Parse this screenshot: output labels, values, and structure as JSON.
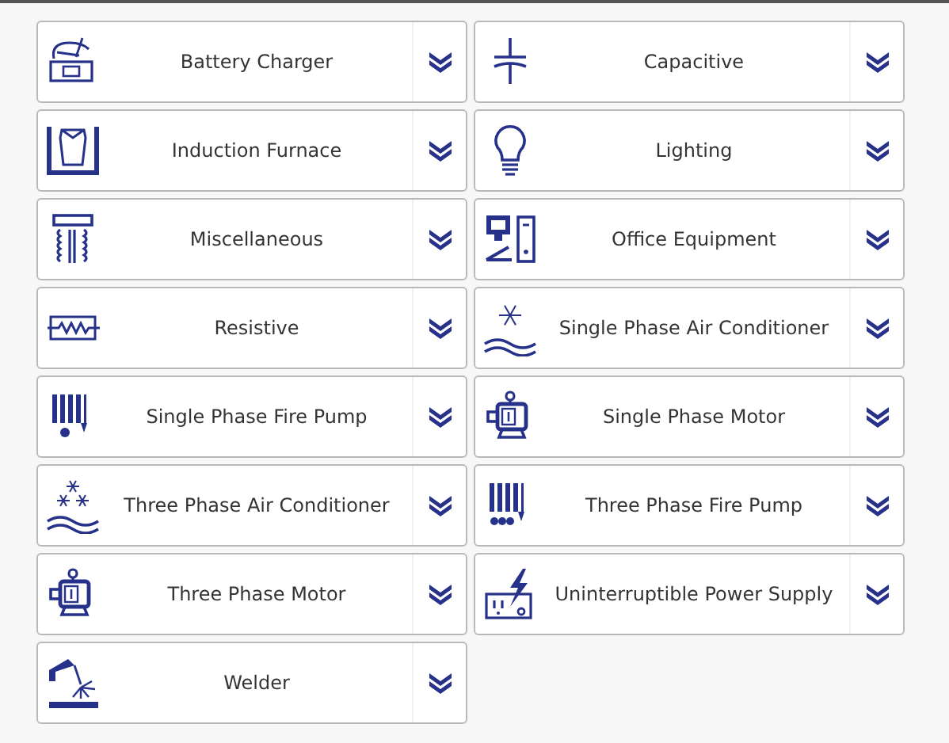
{
  "load_types": [
    {
      "label": "Battery Charger",
      "expanded": false
    },
    {
      "label": "Capacitive",
      "expanded": false
    },
    {
      "label": "Induction Furnace",
      "expanded": false
    },
    {
      "label": "Lighting",
      "expanded": false
    },
    {
      "label": "Miscellaneous",
      "expanded": false
    },
    {
      "label": "Office Equipment",
      "expanded": false
    },
    {
      "label": "Resistive",
      "expanded": false
    },
    {
      "label": "Single Phase Air Conditioner",
      "expanded": false
    },
    {
      "label": "Single Phase Fire Pump",
      "expanded": false
    },
    {
      "label": "Single Phase Motor",
      "expanded": false
    },
    {
      "label": "Three Phase Air Conditioner",
      "expanded": false
    },
    {
      "label": "Three Phase Fire Pump",
      "expanded": false
    },
    {
      "label": "Three Phase Motor",
      "expanded": false
    },
    {
      "label": "Uninterruptible Power Supply",
      "expanded": false
    },
    {
      "label": "Welder",
      "expanded": false
    }
  ]
}
